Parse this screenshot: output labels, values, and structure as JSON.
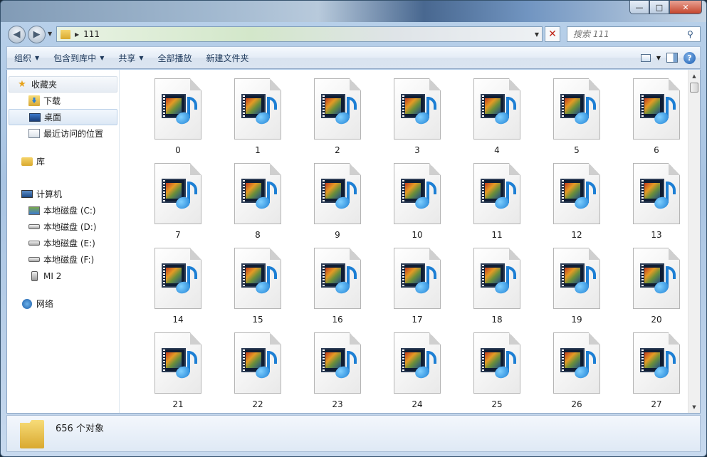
{
  "window": {
    "address_crumb": "111",
    "search_placeholder": "搜索 111",
    "caption": {
      "minimize": "—",
      "maximize": "□",
      "close": "✕"
    }
  },
  "toolbar": {
    "organize": "组织",
    "include_in_library": "包含到库中",
    "share": "共享",
    "play_all": "全部播放",
    "new_folder": "新建文件夹"
  },
  "sidebar": {
    "favorites": {
      "label": "收藏夹",
      "items": [
        {
          "label": "下载",
          "icon": "download-folder-icon"
        },
        {
          "label": "桌面",
          "icon": "desktop-icon",
          "selected": true
        },
        {
          "label": "最近访问的位置",
          "icon": "recent-places-icon"
        }
      ]
    },
    "libraries": {
      "label": "库"
    },
    "computer": {
      "label": "计算机",
      "items": [
        {
          "label": "本地磁盘 (C:)",
          "icon": "system-drive-icon"
        },
        {
          "label": "本地磁盘 (D:)",
          "icon": "drive-icon"
        },
        {
          "label": "本地磁盘 (E:)",
          "icon": "drive-icon"
        },
        {
          "label": "本地磁盘 (F:)",
          "icon": "drive-icon"
        },
        {
          "label": "MI 2",
          "icon": "phone-icon"
        }
      ]
    },
    "network": {
      "label": "网络"
    }
  },
  "files": [
    "0",
    "1",
    "2",
    "3",
    "4",
    "5",
    "6",
    "7",
    "8",
    "9",
    "10",
    "11",
    "12",
    "13",
    "14",
    "15",
    "16",
    "17",
    "18",
    "19",
    "20",
    "21",
    "22",
    "23",
    "24",
    "25",
    "26",
    "27"
  ],
  "status": {
    "count_text": "656 个对象"
  }
}
